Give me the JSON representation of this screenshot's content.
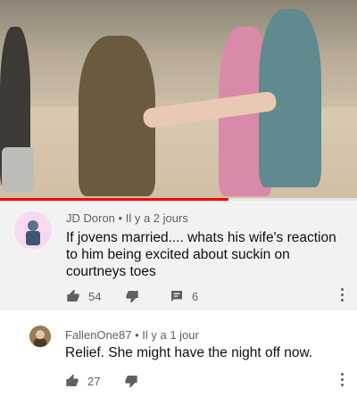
{
  "video": {
    "progress": 0.64,
    "colors": {
      "progress": "#ff0000",
      "track": "#e6e6e6"
    }
  },
  "comments": [
    {
      "author": "JD Doron",
      "separator": "•",
      "time": "Il y a 2 jours",
      "text": "If jovens married.... whats his wife's reaction to him being excited about suckin on courtneys toes",
      "likes": "54",
      "replies": "6",
      "icons": {
        "like": "thumb-up-icon",
        "dislike": "thumb-down-icon",
        "reply": "comment-icon",
        "menu": "more-vert-icon"
      }
    },
    {
      "author": "FallenOne87",
      "separator": "•",
      "time": "Il y a 1 jour",
      "text": "Relief. She might have the night off now.",
      "likes": "27",
      "icons": {
        "like": "thumb-up-icon",
        "dislike": "thumb-down-icon",
        "menu": "more-vert-icon"
      }
    }
  ]
}
